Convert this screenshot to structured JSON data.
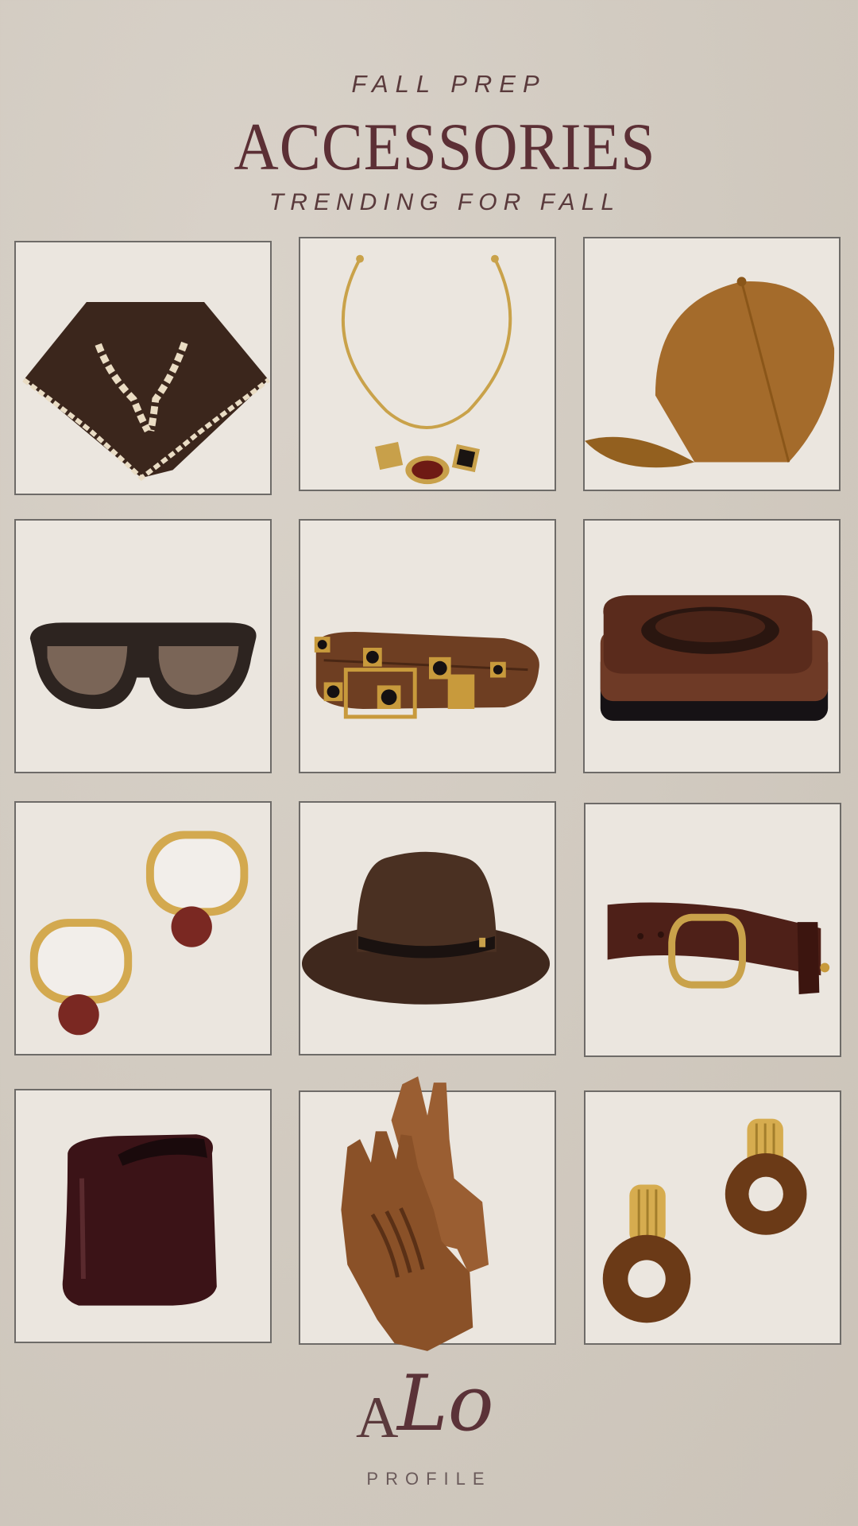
{
  "header": {
    "kicker": "FALL PREP",
    "title": "ACCESSORIES",
    "subtitle": "TRENDING FOR FALL"
  },
  "products": [
    {
      "name": "scarf-icon"
    },
    {
      "name": "necklace-icon"
    },
    {
      "name": "cap-icon"
    },
    {
      "name": "sunglasses-icon"
    },
    {
      "name": "studded-belt-icon"
    },
    {
      "name": "bangle-icon"
    },
    {
      "name": "pearl-earrings-icon"
    },
    {
      "name": "fedora-icon"
    },
    {
      "name": "leather-belt-icon"
    },
    {
      "name": "cuff-icon"
    },
    {
      "name": "gloves-icon"
    },
    {
      "name": "hoop-earrings-icon"
    }
  ],
  "footer": {
    "logo_a": "A",
    "logo_lo": "Lo",
    "profile": "PROFILE"
  },
  "colors": {
    "background": "#d2cbc1",
    "tile": "#ebe6df",
    "title": "#5c2f35",
    "brown": "#3b2419",
    "camel": "#a06a2c",
    "gold": "#c8a04a"
  }
}
